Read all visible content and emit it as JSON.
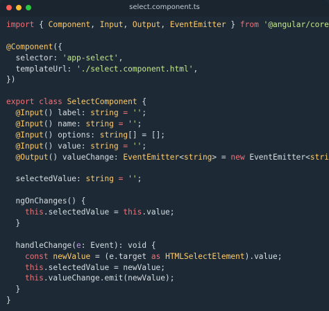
{
  "window": {
    "title": "select.component.ts"
  },
  "code": {
    "lines": [
      [
        {
          "t": "import",
          "c": "k"
        },
        {
          "t": " { ",
          "c": "d"
        },
        {
          "t": "Component",
          "c": "y"
        },
        {
          "t": ", ",
          "c": "d"
        },
        {
          "t": "Input",
          "c": "y"
        },
        {
          "t": ", ",
          "c": "d"
        },
        {
          "t": "Output",
          "c": "y"
        },
        {
          "t": ", ",
          "c": "d"
        },
        {
          "t": "EventEmitter",
          "c": "y"
        },
        {
          "t": " } ",
          "c": "d"
        },
        {
          "t": "from",
          "c": "k"
        },
        {
          "t": " ",
          "c": "d"
        },
        {
          "t": "'@angular/core'",
          "c": "s"
        },
        {
          "t": ";",
          "c": "d"
        }
      ],
      [],
      [
        {
          "t": "@Component",
          "c": "y"
        },
        {
          "t": "({",
          "c": "d"
        }
      ],
      [
        {
          "t": "  selector: ",
          "c": "d"
        },
        {
          "t": "'app-select'",
          "c": "s"
        },
        {
          "t": ",",
          "c": "d"
        }
      ],
      [
        {
          "t": "  templateUrl: ",
          "c": "d"
        },
        {
          "t": "'./select.component.html'",
          "c": "s"
        },
        {
          "t": ",",
          "c": "d"
        }
      ],
      [
        {
          "t": "})",
          "c": "d"
        }
      ],
      [],
      [
        {
          "t": "export",
          "c": "k"
        },
        {
          "t": " ",
          "c": "d"
        },
        {
          "t": "class",
          "c": "k"
        },
        {
          "t": " ",
          "c": "d"
        },
        {
          "t": "SelectComponent",
          "c": "y"
        },
        {
          "t": " {",
          "c": "d"
        }
      ],
      [
        {
          "t": "  ",
          "c": "d"
        },
        {
          "t": "@Input",
          "c": "y"
        },
        {
          "t": "() label: ",
          "c": "d"
        },
        {
          "t": "string",
          "c": "y"
        },
        {
          "t": " = ",
          "c": "k"
        },
        {
          "t": "''",
          "c": "s"
        },
        {
          "t": ";",
          "c": "d"
        }
      ],
      [
        {
          "t": "  ",
          "c": "d"
        },
        {
          "t": "@Input",
          "c": "y"
        },
        {
          "t": "() name: ",
          "c": "d"
        },
        {
          "t": "string",
          "c": "y"
        },
        {
          "t": " = ",
          "c": "k"
        },
        {
          "t": "''",
          "c": "s"
        },
        {
          "t": ";",
          "c": "d"
        }
      ],
      [
        {
          "t": "  ",
          "c": "d"
        },
        {
          "t": "@Input",
          "c": "y"
        },
        {
          "t": "() options: ",
          "c": "d"
        },
        {
          "t": "string",
          "c": "y"
        },
        {
          "t": "[] = [];",
          "c": "d"
        }
      ],
      [
        {
          "t": "  ",
          "c": "d"
        },
        {
          "t": "@Input",
          "c": "y"
        },
        {
          "t": "() value: ",
          "c": "d"
        },
        {
          "t": "string",
          "c": "y"
        },
        {
          "t": " = ",
          "c": "k"
        },
        {
          "t": "''",
          "c": "s"
        },
        {
          "t": ";",
          "c": "d"
        }
      ],
      [
        {
          "t": "  ",
          "c": "d"
        },
        {
          "t": "@Output",
          "c": "y"
        },
        {
          "t": "() valueChange: ",
          "c": "d"
        },
        {
          "t": "EventEmitter",
          "c": "y"
        },
        {
          "t": "<",
          "c": "d"
        },
        {
          "t": "string",
          "c": "y"
        },
        {
          "t": "> = ",
          "c": "d"
        },
        {
          "t": "new",
          "c": "k"
        },
        {
          "t": " EventEmitter<",
          "c": "d"
        },
        {
          "t": "string",
          "c": "y"
        },
        {
          "t": ">();",
          "c": "d"
        }
      ],
      [],
      [
        {
          "t": "  selectedValue: ",
          "c": "d"
        },
        {
          "t": "string",
          "c": "y"
        },
        {
          "t": " = ",
          "c": "k"
        },
        {
          "t": "''",
          "c": "s"
        },
        {
          "t": ";",
          "c": "d"
        }
      ],
      [],
      [
        {
          "t": "  ngOnChanges() {",
          "c": "d"
        }
      ],
      [
        {
          "t": "    ",
          "c": "d"
        },
        {
          "t": "this",
          "c": "k"
        },
        {
          "t": ".selectedValue = ",
          "c": "d"
        },
        {
          "t": "this",
          "c": "k"
        },
        {
          "t": ".value;",
          "c": "d"
        }
      ],
      [
        {
          "t": "  }",
          "c": "d"
        }
      ],
      [],
      [
        {
          "t": "  handleChange(",
          "c": "d"
        },
        {
          "t": "e",
          "c": "p"
        },
        {
          "t": ": Event): void {",
          "c": "d"
        }
      ],
      [
        {
          "t": "    ",
          "c": "d"
        },
        {
          "t": "const",
          "c": "k"
        },
        {
          "t": " ",
          "c": "d"
        },
        {
          "t": "newValue",
          "c": "y"
        },
        {
          "t": " = (e.target ",
          "c": "d"
        },
        {
          "t": "as",
          "c": "k"
        },
        {
          "t": " ",
          "c": "d"
        },
        {
          "t": "HTMLSelectElement",
          "c": "y"
        },
        {
          "t": ").value;",
          "c": "d"
        }
      ],
      [
        {
          "t": "    ",
          "c": "d"
        },
        {
          "t": "this",
          "c": "k"
        },
        {
          "t": ".selectedValue = newValue;",
          "c": "d"
        }
      ],
      [
        {
          "t": "    ",
          "c": "d"
        },
        {
          "t": "this",
          "c": "k"
        },
        {
          "t": ".valueChange.emit(newValue);",
          "c": "d"
        }
      ],
      [
        {
          "t": "  }",
          "c": "d"
        }
      ],
      [
        {
          "t": "}",
          "c": "d"
        }
      ]
    ]
  }
}
